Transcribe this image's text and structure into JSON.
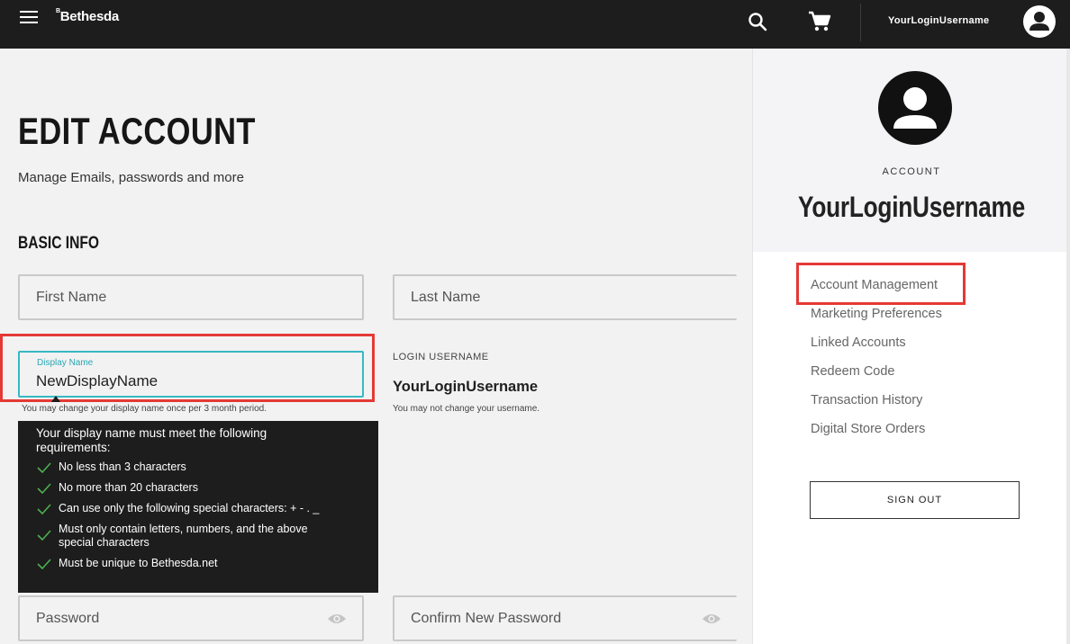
{
  "header": {
    "logo": "Bethesda",
    "logo_mark": "B",
    "username": "YourLoginUsername",
    "icons": [
      "menu-icon",
      "search-icon",
      "cart-icon",
      "user-icon"
    ]
  },
  "main": {
    "title": "EDIT ACCOUNT",
    "subtitle": "Manage Emails, passwords and more",
    "section_title": "BASIC INFO",
    "first_name_placeholder": "First Name",
    "last_name_placeholder": "Last Name",
    "display_name": {
      "label": "Display Name",
      "value": "NewDisplayName",
      "help": "You may change your display name once per 3 month period."
    },
    "tooltip": {
      "title": "Your display name must meet the following requirements:",
      "requirements": [
        "No less than 3 characters",
        "No more than 20 characters",
        "Can use only the following special characters: + - . _",
        "Must only contain letters, numbers, and the above special characters",
        "Must be unique to Bethesda.net"
      ]
    },
    "login_username": {
      "label": "LOGIN USERNAME",
      "value": "YourLoginUsername",
      "help": "You may not change your username."
    },
    "password_placeholder": "Password",
    "confirm_password_placeholder": "Confirm New Password"
  },
  "sidebar": {
    "account_label": "ACCOUNT",
    "username": "YourLoginUsername",
    "items": [
      {
        "label": "Account Management"
      },
      {
        "label": "Marketing Preferences"
      },
      {
        "label": "Linked Accounts"
      },
      {
        "label": "Redeem Code"
      },
      {
        "label": "Transaction History"
      },
      {
        "label": "Digital Store Orders"
      }
    ],
    "signout_label": "SIGN OUT"
  },
  "colors": {
    "topbar": "#1d1d1d",
    "focus_accent": "#36b9c3",
    "highlight": "#e53935",
    "check": "#4caf50"
  }
}
